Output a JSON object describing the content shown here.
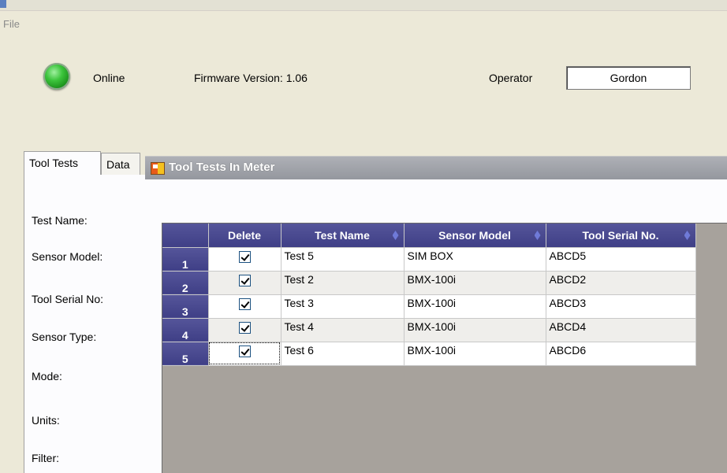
{
  "menu": {
    "file": "File"
  },
  "header": {
    "status": "Online",
    "firmware": "Firmware Version: 1.06",
    "operator_label": "Operator",
    "operator_value": "Gordon",
    "status_color": "#2fb52f"
  },
  "tabs": [
    {
      "label": "Tool Tests",
      "active": true
    },
    {
      "label": "Data",
      "active": false
    }
  ],
  "fields": [
    "Test Name:",
    "Sensor Model:",
    "Tool Serial No:",
    "Sensor Type:",
    "Mode:",
    "Units:",
    "Filter:"
  ],
  "form": {
    "title": "Tool Tests In Meter",
    "icon": "form-icon"
  },
  "grid": {
    "columns": [
      "",
      "Delete",
      "Test Name",
      "Sensor Model",
      "Tool Serial No."
    ],
    "rows": [
      {
        "num": "1",
        "delete": true,
        "test_name": "Test 5",
        "sensor_model": "SIM BOX",
        "serial": "ABCD5"
      },
      {
        "num": "2",
        "delete": true,
        "test_name": "Test 2",
        "sensor_model": "BMX-100i",
        "serial": "ABCD2"
      },
      {
        "num": "3",
        "delete": true,
        "test_name": "Test 3",
        "sensor_model": "BMX-100i",
        "serial": "ABCD3"
      },
      {
        "num": "4",
        "delete": true,
        "test_name": "Test 4",
        "sensor_model": "BMX-100i",
        "serial": "ABCD4"
      },
      {
        "num": "5",
        "delete": true,
        "test_name": "Test 6",
        "sensor_model": "BMX-100i",
        "serial": "ABCD6"
      }
    ],
    "header_color": "#4a4a90"
  }
}
